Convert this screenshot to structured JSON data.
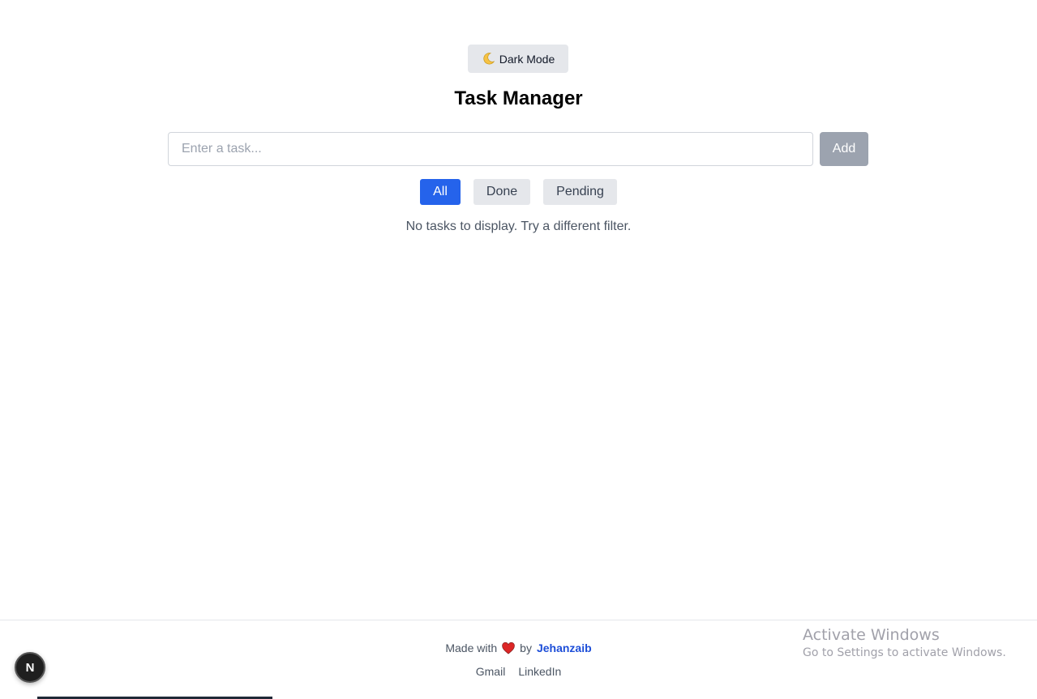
{
  "header": {
    "theme_toggle_label": "Dark Mode",
    "title": "Task Manager"
  },
  "task_form": {
    "input_value": "",
    "input_placeholder": "Enter a task...",
    "add_label": "Add"
  },
  "filters": {
    "items": [
      {
        "label": "All",
        "active": true
      },
      {
        "label": "Done",
        "active": false
      },
      {
        "label": "Pending",
        "active": false
      }
    ]
  },
  "empty_message": "No tasks to display. Try a different filter.",
  "footer": {
    "made_with": "Made with",
    "by": "by",
    "author": "Jehanzaib",
    "links": [
      "Gmail",
      "LinkedIn"
    ]
  },
  "watermark": {
    "title": "Activate Windows",
    "subtitle": "Go to Settings to activate Windows."
  },
  "next_badge": "N",
  "icons": {
    "theme": "moon-icon",
    "love": "heart-icon"
  },
  "colors": {
    "accent": "#2563eb",
    "author_link": "#1d4ed8",
    "heart": "#dc2626"
  }
}
